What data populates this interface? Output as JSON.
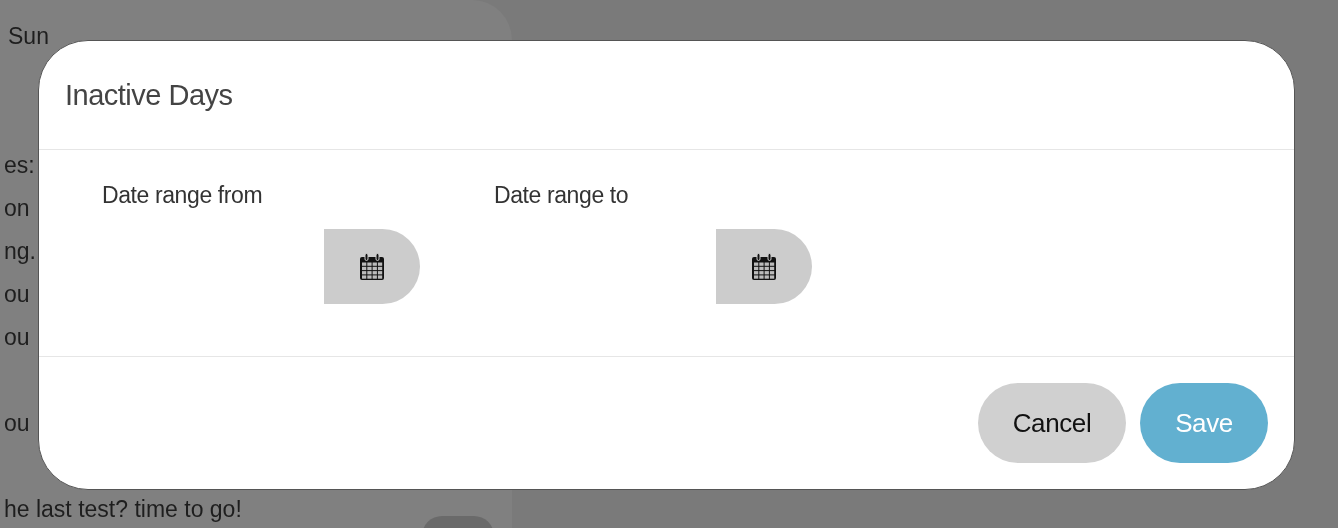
{
  "background": {
    "lines": [
      "Sun",
      "es:",
      "on",
      "ng.",
      "ou",
      "ou",
      "ou",
      "he last test? time to go!"
    ]
  },
  "dialog": {
    "title": "Inactive Days",
    "fields": [
      {
        "label": "Date range from"
      },
      {
        "label": "Date range to"
      }
    ],
    "buttons": [
      {
        "label": "Cancel",
        "kind": "secondary"
      },
      {
        "label": "Save",
        "kind": "primary"
      }
    ]
  }
}
